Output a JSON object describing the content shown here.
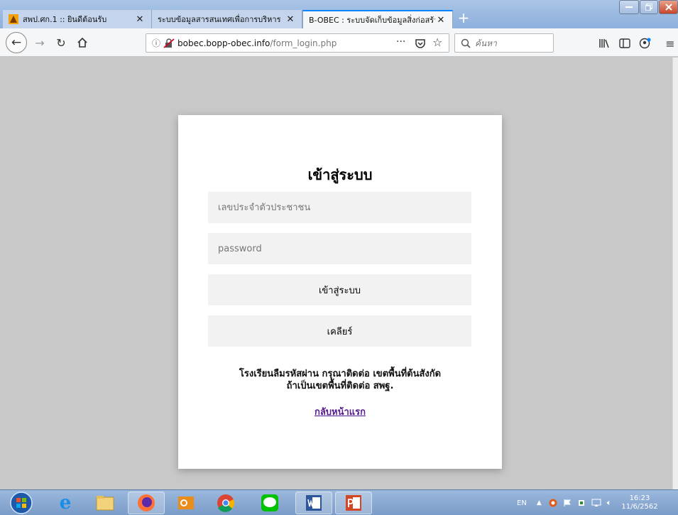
{
  "tabs": [
    {
      "title": "สพป.ศก.1 :: ยินดีต้อนรับ",
      "active": false
    },
    {
      "title": "ระบบข้อมูลสารสนเทศเพื่อการบริหาร",
      "active": false
    },
    {
      "title": "B-OBEC : ระบบจัดเก็บข้อมูลสิ่งก่อสร้าง",
      "active": true
    }
  ],
  "newtab_label": "+",
  "url": {
    "host": "bobec.bopp-obec.info",
    "path": "/form_login.php"
  },
  "search": {
    "placeholder": "ค้นหา"
  },
  "login": {
    "title": "เข้าสู่ระบบ",
    "id_placeholder": "เลขประจำตัวประชาชน",
    "password_placeholder": "password",
    "submit_label": "เข้าสู่ระบบ",
    "clear_label": "เคลียร์",
    "note_line1": "โรงเรียนลืมรหัสผ่าน กรุณาติดต่อ เขตพื้นที่ต้นสังกัด",
    "note_line2": "ถ้าเป็นเขตพื้นที่ติดต่อ สพฐ.",
    "home_link": "กลับหน้าแรก"
  },
  "taskbar": {
    "lang": "EN",
    "time": "16:23",
    "date": "11/6/2562"
  },
  "colors": {
    "accent": "#0a84ff",
    "link": "#551a8b",
    "page_bg": "#c8c8c8"
  }
}
